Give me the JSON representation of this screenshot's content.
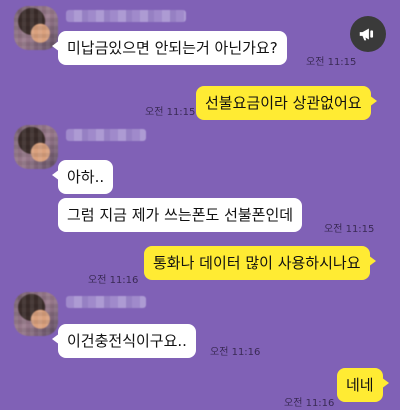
{
  "messages": [
    {
      "side": "in",
      "text": "미납금있으면 안되는거 아닌가요?",
      "time": "오전 11:15"
    },
    {
      "side": "out",
      "text": "선불요금이라 상관없어요",
      "time": "오전 11:15"
    },
    {
      "side": "in",
      "text": "아하..",
      "time": ""
    },
    {
      "side": "in",
      "text": "그럼 지금 제가 쓰는폰도 선불폰인데",
      "time": "오전 11:15"
    },
    {
      "side": "out",
      "text": "통화나 데이터 많이 사용하시나요",
      "time": "오전 11:16"
    },
    {
      "side": "in",
      "text": "이건충전식이구요..",
      "time": "오전 11:16"
    },
    {
      "side": "out",
      "text": "네네",
      "time": "오전 11:16"
    }
  ],
  "icons": {
    "megaphone": "megaphone-icon",
    "avatar": "blurred-profile-avatar"
  },
  "colors": {
    "background": "#8061b6",
    "incoming_bubble": "#ffffff",
    "outgoing_bubble": "#ffeb33"
  }
}
